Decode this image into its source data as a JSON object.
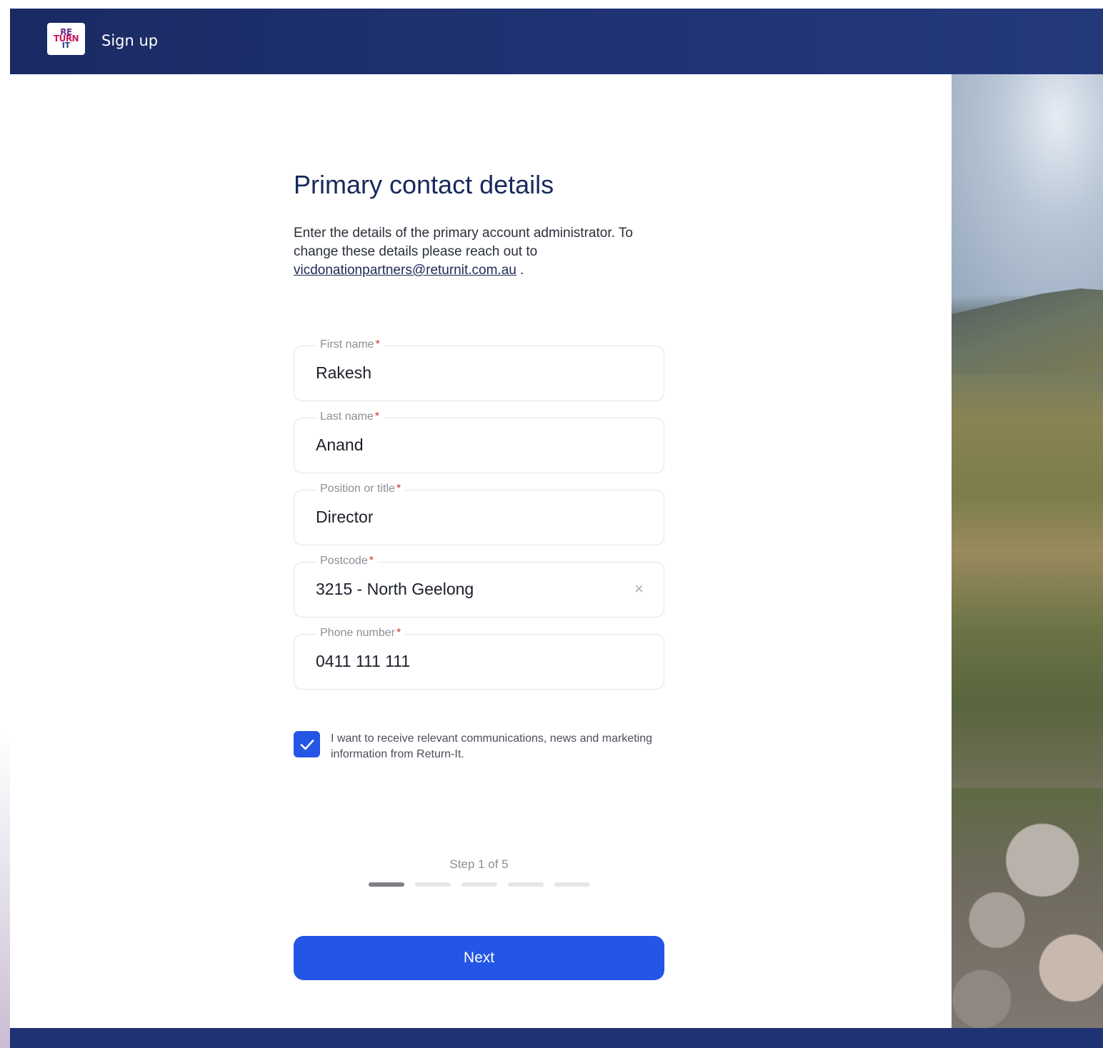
{
  "header": {
    "logo_lines": [
      "RE",
      "TURN",
      "IT"
    ],
    "title": "Sign up"
  },
  "form": {
    "heading": "Primary contact details",
    "intro_text": "Enter the details of the primary account administrator. To change these details please reach out to ",
    "intro_email": "vicdonationpartners@returnit.com.au",
    "intro_end": " .",
    "fields": [
      {
        "label": "First name",
        "required": "*",
        "value": "Rakesh"
      },
      {
        "label": "Last name",
        "required": "*",
        "value": "Anand"
      },
      {
        "label": "Position or title",
        "required": "*",
        "value": "Director"
      },
      {
        "label": "Postcode",
        "required": "*",
        "value": "3215 - North Geelong",
        "clear_icon": "×"
      },
      {
        "label": "Phone number",
        "required": "*",
        "value": "0411 111 111"
      }
    ],
    "marketing_opt_in": {
      "checked": true,
      "label": "I want to receive relevant communications, news and marketing information from Return-It."
    },
    "progress": {
      "label": "Step 1 of 5",
      "current_step": 1,
      "total_steps": 5
    },
    "next_button": "Next"
  },
  "colors": {
    "header_bg": "#1f3273",
    "heading": "#17295e",
    "accent": "#2456e5",
    "required": "#d0312d"
  }
}
